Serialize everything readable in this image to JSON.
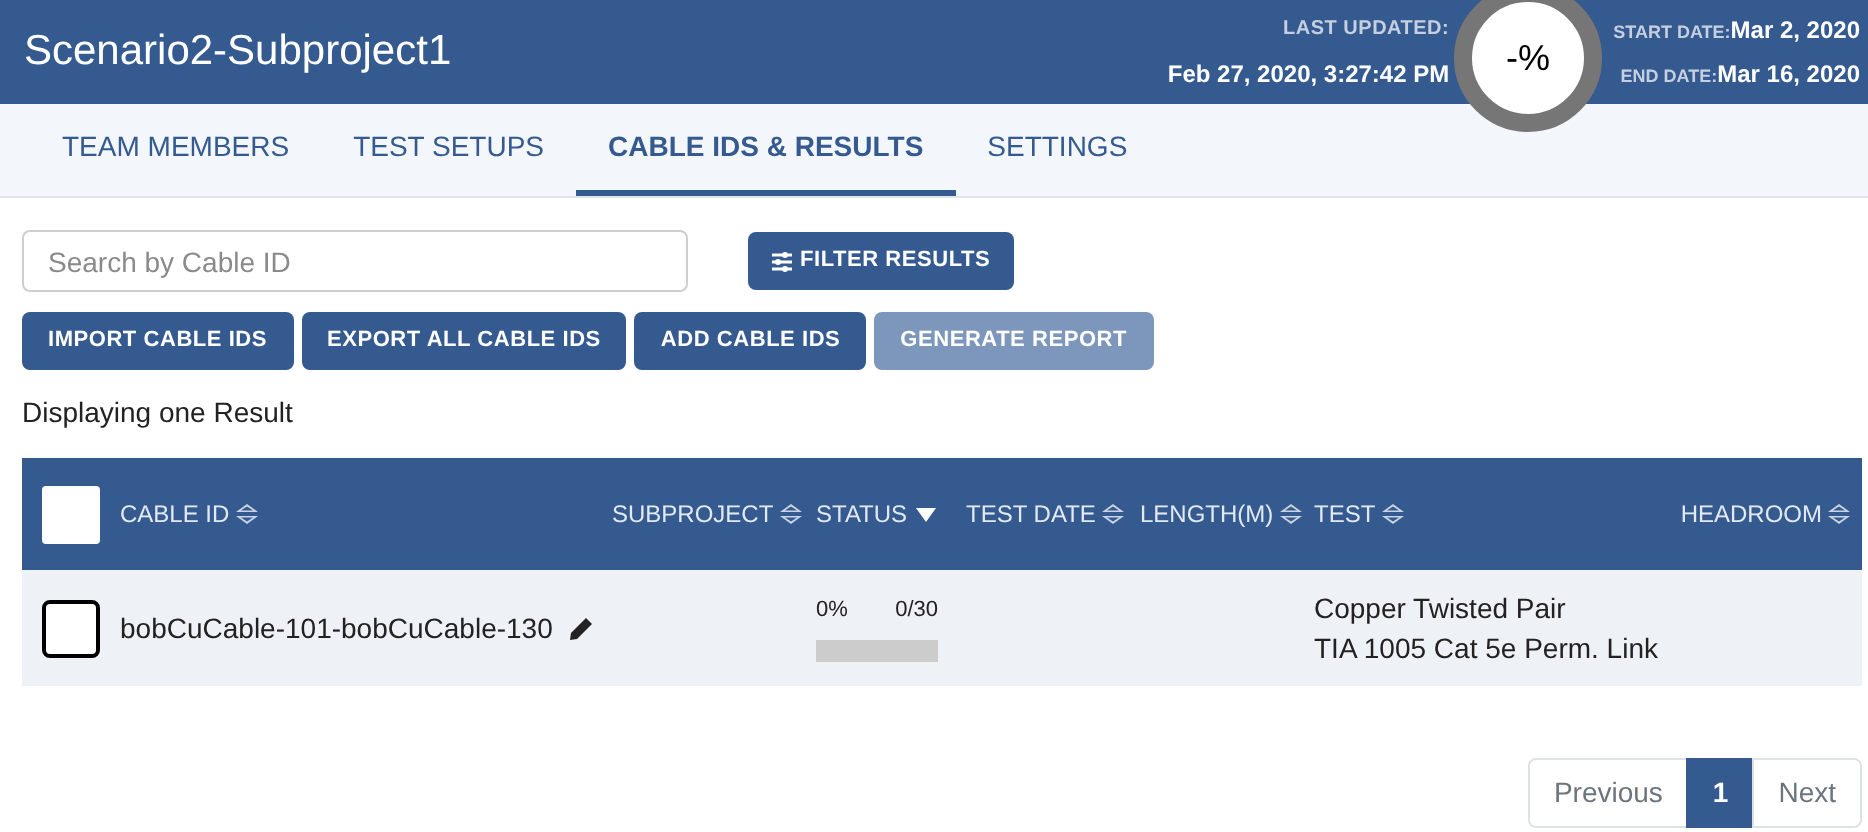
{
  "header": {
    "title": "Scenario2-Subproject1",
    "last_updated_label": "LAST UPDATED:",
    "last_updated": "Feb 27, 2020, 3:27:42 PM",
    "progress": "-%",
    "start_label": "START DATE:",
    "start_date": "Mar 2, 2020",
    "end_label": "END DATE:",
    "end_date": "Mar 16, 2020"
  },
  "tabs": [
    {
      "label": "TEAM MEMBERS",
      "selected": false
    },
    {
      "label": "TEST SETUPS",
      "selected": false
    },
    {
      "label": "CABLE IDS & RESULTS",
      "selected": true
    },
    {
      "label": "SETTINGS",
      "selected": false
    }
  ],
  "search": {
    "placeholder": "Search by Cable ID"
  },
  "filter_button": "FILTER RESULTS",
  "actions": [
    {
      "label": "IMPORT CABLE IDS",
      "disabled": false
    },
    {
      "label": "EXPORT ALL CABLE IDS",
      "disabled": false
    },
    {
      "label": "ADD CABLE IDS",
      "disabled": false
    },
    {
      "label": "GENERATE REPORT",
      "disabled": true
    }
  ],
  "result_count": "Displaying one Result",
  "table": {
    "columns": [
      {
        "label": "CABLE ID",
        "sorted": false
      },
      {
        "label": "SUBPROJECT",
        "sorted": false
      },
      {
        "label": "STATUS",
        "sorted": true
      },
      {
        "label": "TEST DATE",
        "sorted": false
      },
      {
        "label": "LENGTH(M)",
        "sorted": false
      },
      {
        "label": "TEST",
        "sorted": false
      },
      {
        "label": "HEADROOM",
        "sorted": false
      }
    ],
    "select_all_checked": false,
    "rows": [
      {
        "checked": false,
        "cable_id": "bobCuCable-101-bobCuCable-130",
        "status_percent": "0%",
        "status_count": "0/30",
        "level": 0,
        "test_lines": [
          "Copper Twisted Pair",
          "TIA 1005 Cat 5e Perm. Link"
        ]
      }
    ]
  },
  "pagination": [
    {
      "label": "Previous",
      "selected": false
    },
    {
      "label": "1",
      "selected": true
    },
    {
      "label": "Next",
      "selected": false
    }
  ]
}
